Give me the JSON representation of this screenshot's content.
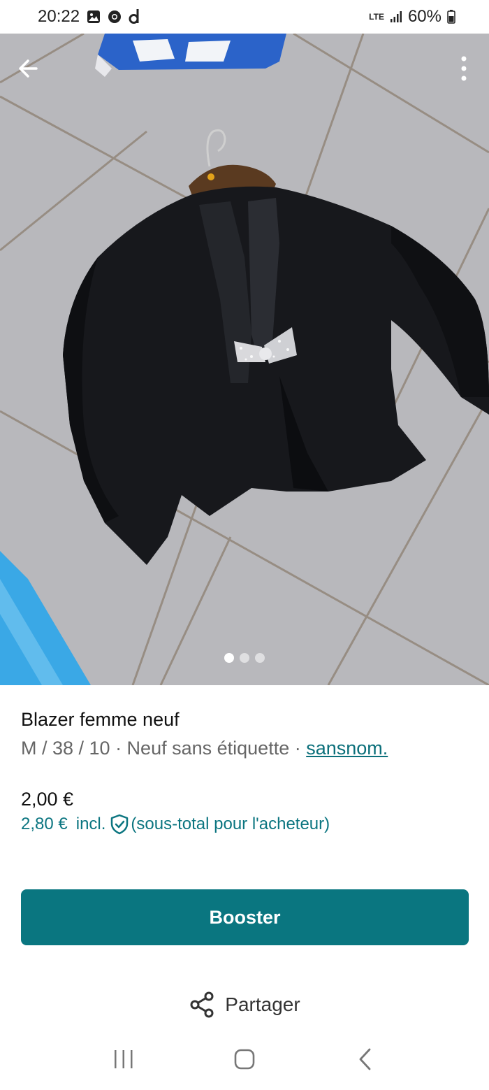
{
  "status_bar": {
    "time": "20:22",
    "network": "LTE",
    "battery": "60%",
    "icons": [
      "gallery-icon",
      "chrome-icon",
      "d-app-icon",
      "signal-icon",
      "battery-icon"
    ]
  },
  "top_nav": {
    "back_icon": "arrow-left-icon",
    "more_icon": "more-vertical-icon"
  },
  "gallery": {
    "photo_count": 3,
    "active_index": 0
  },
  "item": {
    "title": "Blazer femme neuf",
    "meta": "M / 38 / 10 · Neuf sans étiquette · ",
    "brand": "sansnom.",
    "price": "2,00 €",
    "price_incl_amount": "2,80 €",
    "price_incl_word": "incl.",
    "price_incl_note": "(sous-total pour l'acheteur)"
  },
  "actions": {
    "booster_label": "Booster",
    "share_label": "Partager"
  },
  "colors": {
    "accent": "#0a7680",
    "link": "#0b6f7a"
  },
  "system_nav": {
    "icons": [
      "recent-apps-icon",
      "home-icon",
      "back-icon"
    ]
  }
}
